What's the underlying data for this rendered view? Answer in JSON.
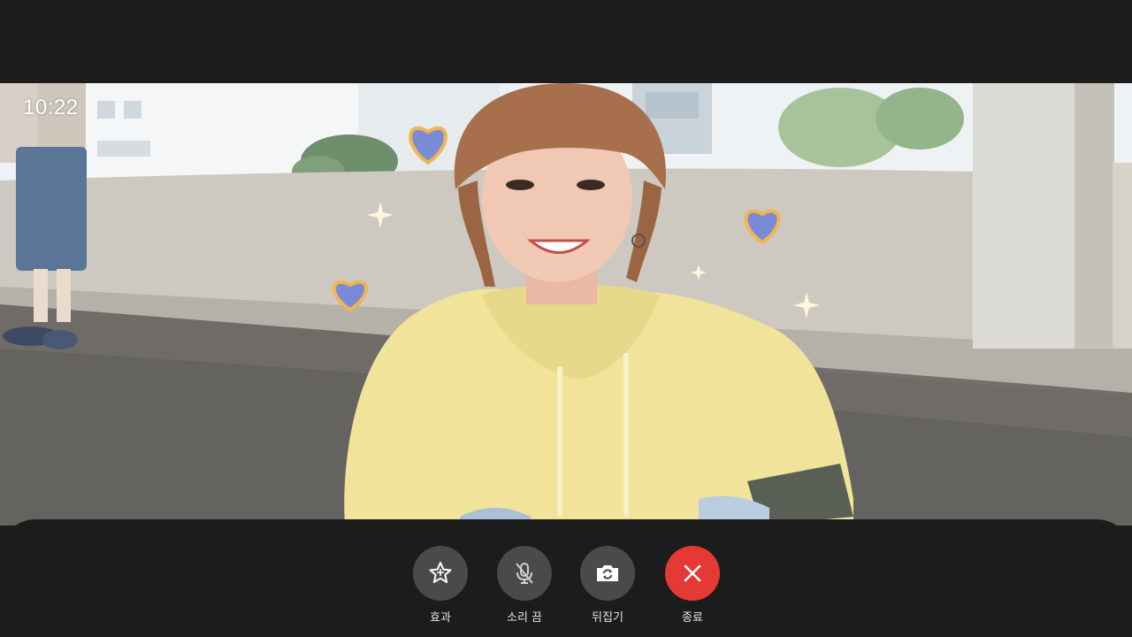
{
  "status": {
    "time": "10:22"
  },
  "controls": [
    {
      "label": "효과",
      "icon": "star-icon"
    },
    {
      "label": "소리 끔",
      "icon": "mic-off-icon"
    },
    {
      "label": "뒤집기",
      "icon": "camera-flip-icon"
    },
    {
      "label": "종료",
      "icon": "close-icon"
    }
  ],
  "colors": {
    "background": "#1c1c1c",
    "button": "#4a4a4a",
    "end_button": "#e53935",
    "hoodie": "#f1e39a"
  }
}
